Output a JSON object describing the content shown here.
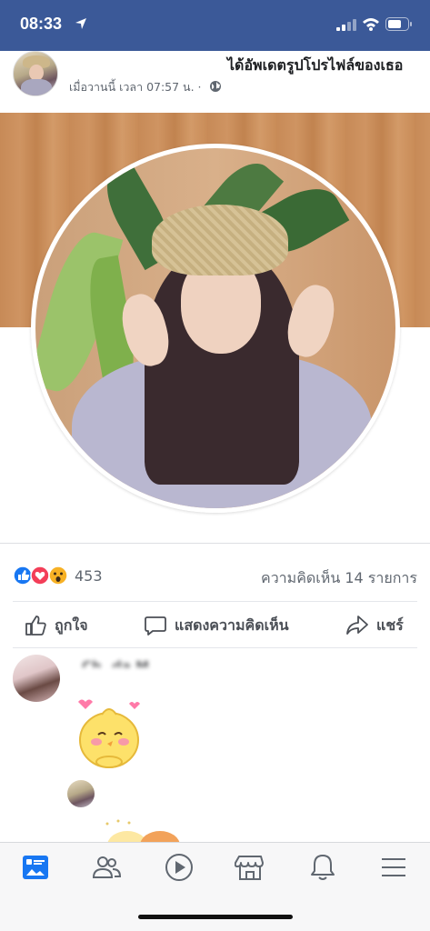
{
  "status_bar": {
    "time": "08:33"
  },
  "post": {
    "title": "ได้อัพเดตรูปโปรไฟล์ของเธอ",
    "meta": "เมื่อวานนี้ เวลา 07:57 น. ·"
  },
  "reactions": {
    "count": "453",
    "icons": [
      "like-icon",
      "love-icon",
      "wow-icon"
    ],
    "comments": "ความคิดเห็น 14 รายการ"
  },
  "actions": {
    "like": "ถูกใจ",
    "comment": "แสดงความคิดเห็น",
    "share": "แชร์"
  },
  "comment": {
    "author": "Ch..da M..."
  },
  "tabs": [
    "news-feed-icon",
    "friends-icon",
    "watch-icon",
    "marketplace-icon",
    "notifications-icon",
    "menu-icon"
  ],
  "colors": {
    "header": "#3b5998",
    "accent": "#1877f2",
    "love": "#f33e58",
    "wow": "#f7b125"
  }
}
